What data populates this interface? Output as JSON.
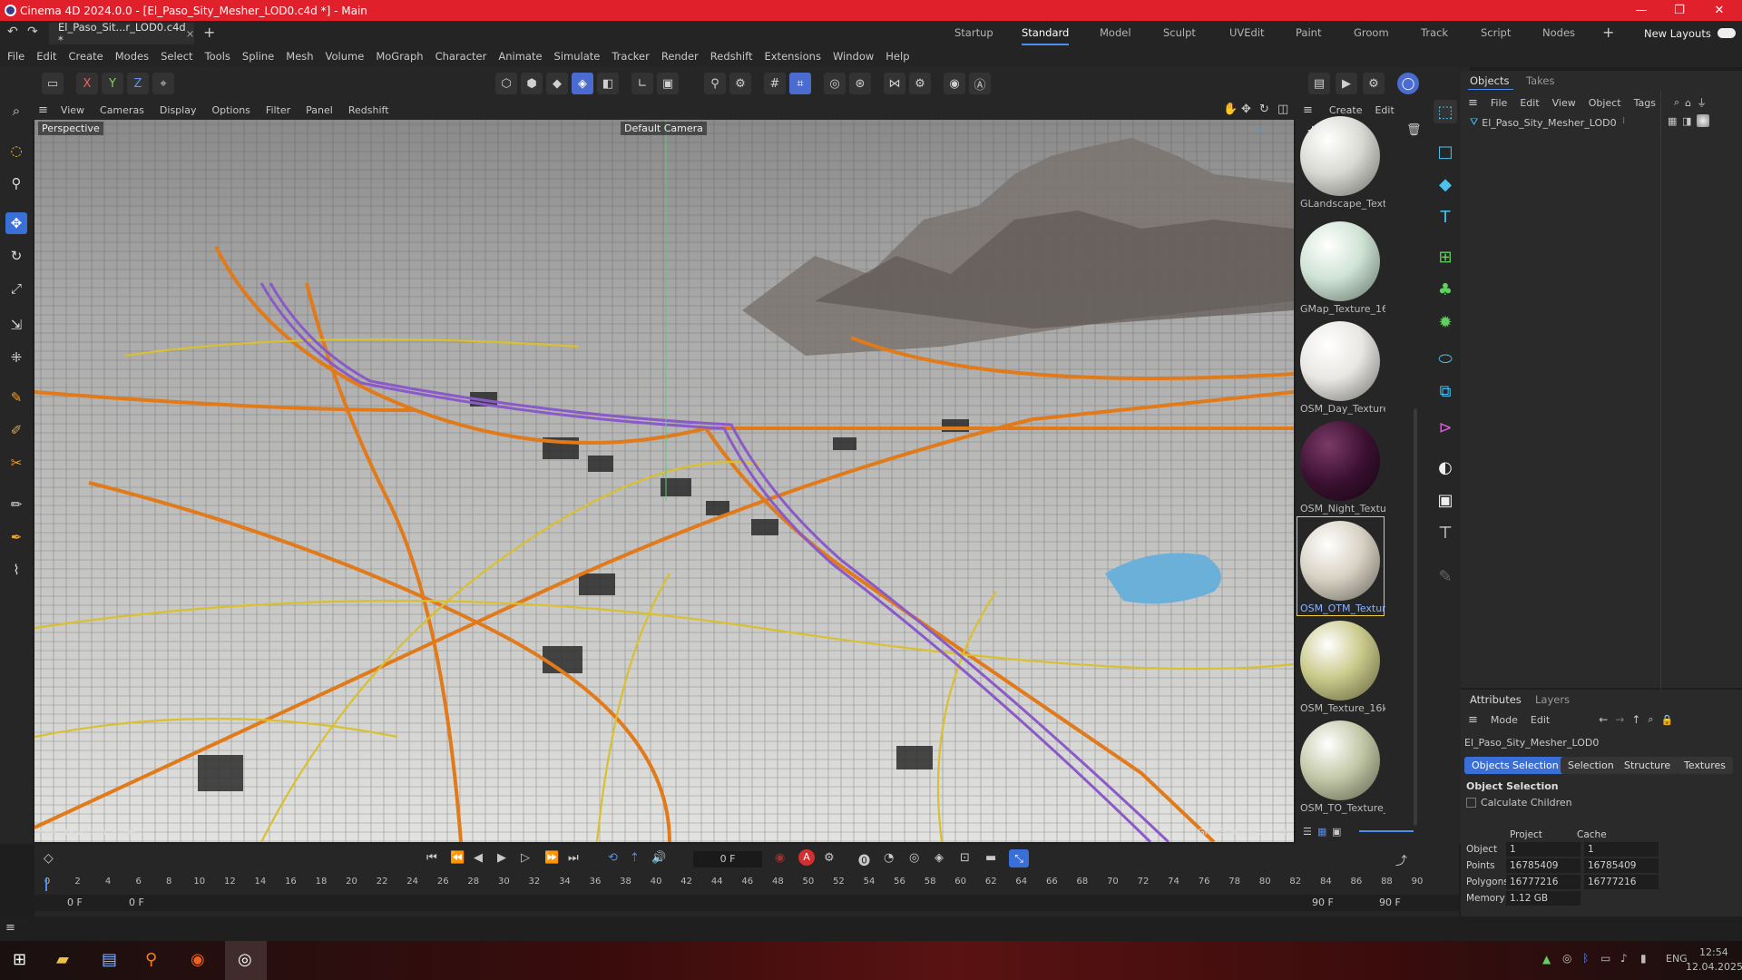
{
  "title": "Cinema 4D 2024.0.0 - [El_Paso_Sity_Mesher_LOD0.c4d *] - Main",
  "window_controls": [
    "—",
    "❐",
    "✕"
  ],
  "doc_tab": "El_Paso_Sit...r_LOD0.c4d *",
  "layouts": [
    "Startup",
    "Standard",
    "Model",
    "Sculpt",
    "UVEdit",
    "Paint",
    "Groom",
    "Track",
    "Script",
    "Nodes"
  ],
  "new_layouts": "New Layouts",
  "menu": [
    "File",
    "Edit",
    "Create",
    "Modes",
    "Select",
    "Tools",
    "Spline",
    "Mesh",
    "Volume",
    "MoGraph",
    "Character",
    "Animate",
    "Simulate",
    "Tracker",
    "Render",
    "Redshift",
    "Extensions",
    "Window",
    "Help"
  ],
  "axis_toggles": [
    "X",
    "Y",
    "Z"
  ],
  "viewport_menu": [
    "View",
    "Cameras",
    "Display",
    "Options",
    "Filter",
    "Panel",
    "Redshift"
  ],
  "viewport": {
    "label": "Perspective",
    "camera": "Default Camera",
    "hud_left": "View Transform: Project",
    "hud_right": "Grid Spacing : 50 cm"
  },
  "material_menu": [
    "Create",
    "Edit"
  ],
  "materials": [
    {
      "name": "GLandscape_Textu",
      "color": "#d9d9d4"
    },
    {
      "name": "GMap_Texture_16",
      "color": "#cfe3d5"
    },
    {
      "name": "OSM_Day_Texture",
      "color": "#e9e7e4"
    },
    {
      "name": "OSM_Night_Textu",
      "color": "#3b1030"
    },
    {
      "name": "OSM_OTM_Textur",
      "color": "#d8d2c4",
      "selected": true
    },
    {
      "name": "OSM_Texture_16k",
      "color": "#c9c98a"
    },
    {
      "name": "OSM_TO_Texture_",
      "color": "#c3c9a8"
    }
  ],
  "objects_panel": {
    "tabs": [
      "Objects",
      "Takes"
    ],
    "menu": [
      "File",
      "Edit",
      "View",
      "Object",
      "Tags"
    ],
    "item": "El_Paso_Sity_Mesher_LOD0"
  },
  "attributes_panel": {
    "tabs": [
      "Attributes",
      "Layers"
    ],
    "menu": [
      "Mode",
      "Edit"
    ],
    "object_name": "El_Paso_Sity_Mesher_LOD0",
    "mode_tabs": [
      "Objects Selection",
      "Selection",
      "Structure",
      "Textures"
    ],
    "section": "Object Selection",
    "checkbox": "Calculate Children",
    "col_project": "Project",
    "col_cache": "Cache",
    "rows": [
      {
        "label": "Object",
        "project": "1",
        "cache": "1"
      },
      {
        "label": "Points",
        "project": "16785409",
        "cache": "16785409"
      },
      {
        "label": "Polygons",
        "project": "16777216",
        "cache": "16777216"
      },
      {
        "label": "Memory",
        "project": "1.12 GB",
        "cache": ""
      }
    ]
  },
  "timeline": {
    "current_frame": "0 F",
    "ticks": [
      "0",
      "2",
      "4",
      "6",
      "8",
      "10",
      "12",
      "14",
      "16",
      "18",
      "20",
      "22",
      "24",
      "26",
      "28",
      "30",
      "32",
      "34",
      "36",
      "38",
      "40",
      "42",
      "44",
      "46",
      "48",
      "50",
      "52",
      "54",
      "56",
      "58",
      "60",
      "62",
      "64",
      "66",
      "68",
      "70",
      "72",
      "74",
      "76",
      "78",
      "80",
      "82",
      "84",
      "86",
      "88",
      "90"
    ],
    "start": "0 F",
    "start2": "0 F",
    "end": "90 F",
    "end2": "90 F"
  },
  "taskbar": {
    "lang": "ENG",
    "time": "12:54",
    "date": "12.04.2025"
  },
  "colors": {
    "title_red": "#e0202a",
    "accent_blue": "#3a6fd8",
    "road_orange": "#e07a1a",
    "road_yellow": "#d8c030",
    "freeway_purple": "#8a5ac8"
  }
}
